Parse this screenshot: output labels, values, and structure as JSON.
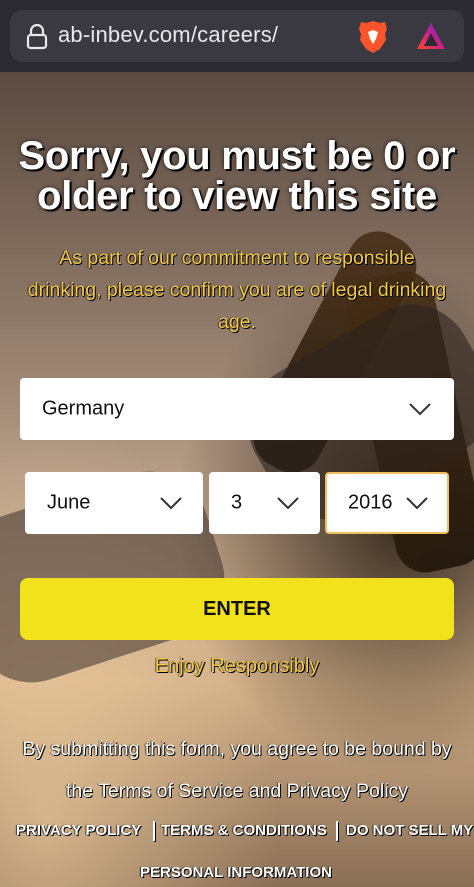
{
  "browser": {
    "url": "ab-inbev.com/careers/",
    "icons": [
      "lock-icon",
      "brave-lion-icon",
      "brave-rewards-icon"
    ]
  },
  "age_gate": {
    "headline_line1": "Sorry, you must be 0 or",
    "headline_line2": "older to view this site",
    "subtext_line1": "As part of our commitment to responsible",
    "subtext_line2": "drinking, please confirm you are of legal drinking",
    "subtext_line3": "age.",
    "country_value": "Germany",
    "month_value": "June",
    "day_value": "3",
    "year_value": "2016",
    "enter_label": "ENTER",
    "enjoy_text": "Enjoy Responsibly",
    "terms_line1": "By submitting this form, you agree to be bound by",
    "terms_line2": "the Terms of Service and Privacy Policy"
  },
  "footer": {
    "privacy_policy": "PRIVACY POLICY",
    "terms_conditions": "TERMS & CONDITIONS",
    "do_not_sell_line1": "DO NOT SELL MY",
    "do_not_sell_line2": "PERSONAL INFORMATION"
  },
  "colors": {
    "accent_yellow": "#f2e21b",
    "text_gold": "#f2c94c",
    "browser_bg": "#2b2a33"
  }
}
